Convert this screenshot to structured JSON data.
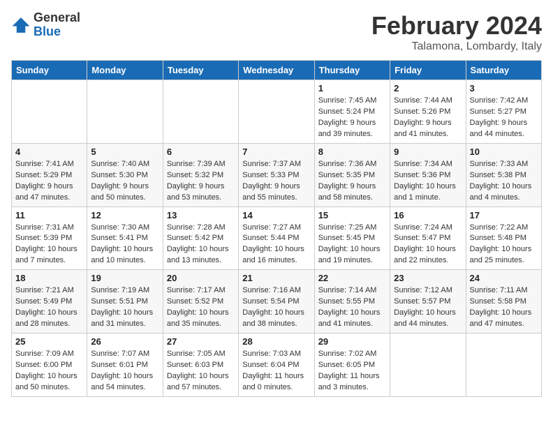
{
  "logo": {
    "general": "General",
    "blue": "Blue"
  },
  "header": {
    "month": "February 2024",
    "location": "Talamona, Lombardy, Italy"
  },
  "days_of_week": [
    "Sunday",
    "Monday",
    "Tuesday",
    "Wednesday",
    "Thursday",
    "Friday",
    "Saturday"
  ],
  "weeks": [
    [
      {
        "day": "",
        "info": ""
      },
      {
        "day": "",
        "info": ""
      },
      {
        "day": "",
        "info": ""
      },
      {
        "day": "",
        "info": ""
      },
      {
        "day": "1",
        "info": "Sunrise: 7:45 AM\nSunset: 5:24 PM\nDaylight: 9 hours\nand 39 minutes."
      },
      {
        "day": "2",
        "info": "Sunrise: 7:44 AM\nSunset: 5:26 PM\nDaylight: 9 hours\nand 41 minutes."
      },
      {
        "day": "3",
        "info": "Sunrise: 7:42 AM\nSunset: 5:27 PM\nDaylight: 9 hours\nand 44 minutes."
      }
    ],
    [
      {
        "day": "4",
        "info": "Sunrise: 7:41 AM\nSunset: 5:29 PM\nDaylight: 9 hours\nand 47 minutes."
      },
      {
        "day": "5",
        "info": "Sunrise: 7:40 AM\nSunset: 5:30 PM\nDaylight: 9 hours\nand 50 minutes."
      },
      {
        "day": "6",
        "info": "Sunrise: 7:39 AM\nSunset: 5:32 PM\nDaylight: 9 hours\nand 53 minutes."
      },
      {
        "day": "7",
        "info": "Sunrise: 7:37 AM\nSunset: 5:33 PM\nDaylight: 9 hours\nand 55 minutes."
      },
      {
        "day": "8",
        "info": "Sunrise: 7:36 AM\nSunset: 5:35 PM\nDaylight: 9 hours\nand 58 minutes."
      },
      {
        "day": "9",
        "info": "Sunrise: 7:34 AM\nSunset: 5:36 PM\nDaylight: 10 hours\nand 1 minute."
      },
      {
        "day": "10",
        "info": "Sunrise: 7:33 AM\nSunset: 5:38 PM\nDaylight: 10 hours\nand 4 minutes."
      }
    ],
    [
      {
        "day": "11",
        "info": "Sunrise: 7:31 AM\nSunset: 5:39 PM\nDaylight: 10 hours\nand 7 minutes."
      },
      {
        "day": "12",
        "info": "Sunrise: 7:30 AM\nSunset: 5:41 PM\nDaylight: 10 hours\nand 10 minutes."
      },
      {
        "day": "13",
        "info": "Sunrise: 7:28 AM\nSunset: 5:42 PM\nDaylight: 10 hours\nand 13 minutes."
      },
      {
        "day": "14",
        "info": "Sunrise: 7:27 AM\nSunset: 5:44 PM\nDaylight: 10 hours\nand 16 minutes."
      },
      {
        "day": "15",
        "info": "Sunrise: 7:25 AM\nSunset: 5:45 PM\nDaylight: 10 hours\nand 19 minutes."
      },
      {
        "day": "16",
        "info": "Sunrise: 7:24 AM\nSunset: 5:47 PM\nDaylight: 10 hours\nand 22 minutes."
      },
      {
        "day": "17",
        "info": "Sunrise: 7:22 AM\nSunset: 5:48 PM\nDaylight: 10 hours\nand 25 minutes."
      }
    ],
    [
      {
        "day": "18",
        "info": "Sunrise: 7:21 AM\nSunset: 5:49 PM\nDaylight: 10 hours\nand 28 minutes."
      },
      {
        "day": "19",
        "info": "Sunrise: 7:19 AM\nSunset: 5:51 PM\nDaylight: 10 hours\nand 31 minutes."
      },
      {
        "day": "20",
        "info": "Sunrise: 7:17 AM\nSunset: 5:52 PM\nDaylight: 10 hours\nand 35 minutes."
      },
      {
        "day": "21",
        "info": "Sunrise: 7:16 AM\nSunset: 5:54 PM\nDaylight: 10 hours\nand 38 minutes."
      },
      {
        "day": "22",
        "info": "Sunrise: 7:14 AM\nSunset: 5:55 PM\nDaylight: 10 hours\nand 41 minutes."
      },
      {
        "day": "23",
        "info": "Sunrise: 7:12 AM\nSunset: 5:57 PM\nDaylight: 10 hours\nand 44 minutes."
      },
      {
        "day": "24",
        "info": "Sunrise: 7:11 AM\nSunset: 5:58 PM\nDaylight: 10 hours\nand 47 minutes."
      }
    ],
    [
      {
        "day": "25",
        "info": "Sunrise: 7:09 AM\nSunset: 6:00 PM\nDaylight: 10 hours\nand 50 minutes."
      },
      {
        "day": "26",
        "info": "Sunrise: 7:07 AM\nSunset: 6:01 PM\nDaylight: 10 hours\nand 54 minutes."
      },
      {
        "day": "27",
        "info": "Sunrise: 7:05 AM\nSunset: 6:03 PM\nDaylight: 10 hours\nand 57 minutes."
      },
      {
        "day": "28",
        "info": "Sunrise: 7:03 AM\nSunset: 6:04 PM\nDaylight: 11 hours\nand 0 minutes."
      },
      {
        "day": "29",
        "info": "Sunrise: 7:02 AM\nSunset: 6:05 PM\nDaylight: 11 hours\nand 3 minutes."
      },
      {
        "day": "",
        "info": ""
      },
      {
        "day": "",
        "info": ""
      }
    ]
  ]
}
